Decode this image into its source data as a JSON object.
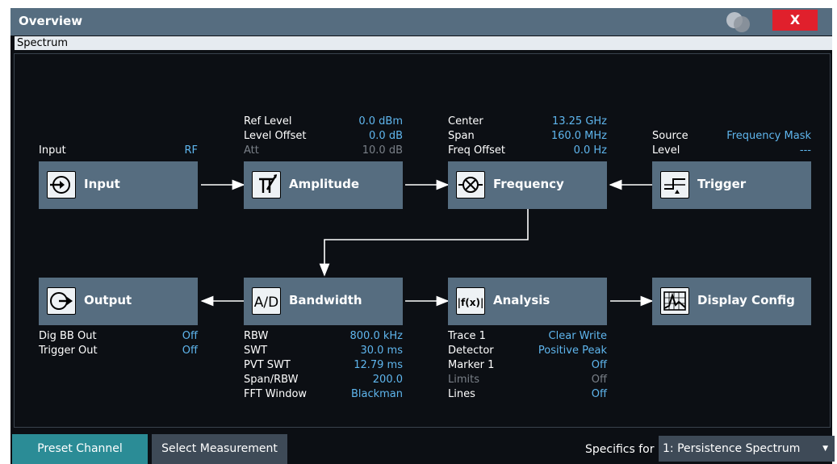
{
  "window": {
    "title": "Overview",
    "close_label": "X",
    "channel_label": "Spectrum"
  },
  "blocks": {
    "input": {
      "label": "Input",
      "icon": "input-icon"
    },
    "amplitude": {
      "label": "Amplitude",
      "icon": "amplitude-icon"
    },
    "frequency": {
      "label": "Frequency",
      "icon": "frequency-mixer-icon"
    },
    "trigger": {
      "label": "Trigger",
      "icon": "trigger-icon"
    },
    "output": {
      "label": "Output",
      "icon": "output-icon"
    },
    "bandwidth": {
      "label": "Bandwidth",
      "icon": "ad-converter-icon",
      "icon_text": "A/D"
    },
    "analysis": {
      "label": "Analysis",
      "icon": "function-icon",
      "icon_text": "|f(x)|"
    },
    "display_config": {
      "label": "Display Config",
      "icon": "display-graph-icon"
    }
  },
  "info": {
    "input": [
      {
        "k": "Input",
        "v": "RF"
      }
    ],
    "amplitude": [
      {
        "k": "Ref Level",
        "v": "0.0 dBm"
      },
      {
        "k": "Level Offset",
        "v": "0.0 dB"
      },
      {
        "k": "Att",
        "v": "10.0 dB",
        "dim": true
      }
    ],
    "frequency": [
      {
        "k": "Center",
        "v": "13.25 GHz"
      },
      {
        "k": "Span",
        "v": "160.0 MHz"
      },
      {
        "k": "Freq Offset",
        "v": "0.0 Hz"
      }
    ],
    "trigger": [
      {
        "k": "Source",
        "v": "Frequency Mask"
      },
      {
        "k": "Level",
        "v": "---"
      }
    ],
    "output": [
      {
        "k": "Dig BB Out",
        "v": "Off"
      },
      {
        "k": "Trigger Out",
        "v": "Off"
      }
    ],
    "bandwidth": [
      {
        "k": "RBW",
        "v": "800.0 kHz"
      },
      {
        "k": "SWT",
        "v": "30.0 ms"
      },
      {
        "k": "PVT SWT",
        "v": "12.79 ms"
      },
      {
        "k": "Span/RBW",
        "v": "200.0"
      },
      {
        "k": "FFT Window",
        "v": "Blackman"
      }
    ],
    "analysis": [
      {
        "k": "Trace 1",
        "v": "Clear Write"
      },
      {
        "k": "Detector",
        "v": "Positive Peak"
      },
      {
        "k": "Marker 1",
        "v": "Off"
      },
      {
        "k": "Limits",
        "v": "Off",
        "dim": true
      },
      {
        "k": "Lines",
        "v": "Off"
      }
    ]
  },
  "footer": {
    "preset_channel": "Preset Channel",
    "select_measurement": "Select Measurement",
    "specifics_for_label": "Specifics for",
    "specifics_for_value": "1: Persistence Spectrum"
  },
  "colors": {
    "title_bar": "#566d80",
    "close": "#e0202c",
    "block": "#566d80",
    "value_text": "#5fb6ee",
    "preset_button": "#2b8c96"
  }
}
